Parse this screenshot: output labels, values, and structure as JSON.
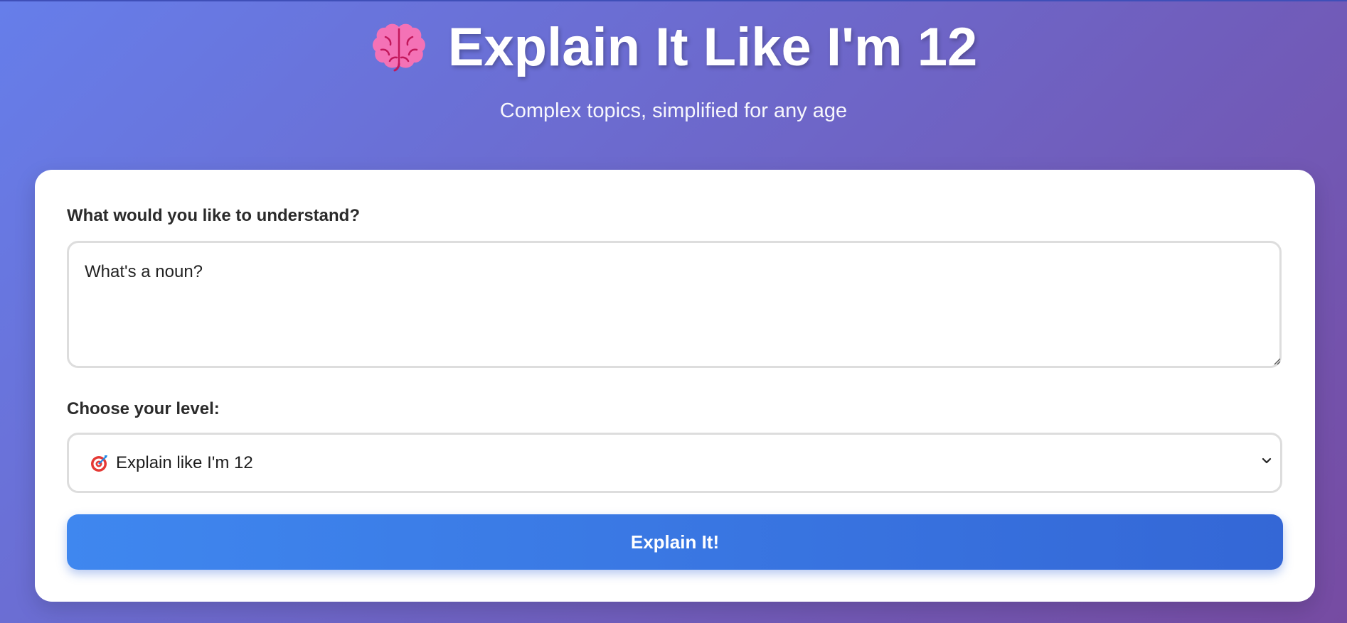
{
  "header": {
    "title": "Explain It Like I'm 12",
    "title_icon": "brain-icon",
    "subtitle": "Complex topics, simplified for any age"
  },
  "form": {
    "question_label": "What would you like to understand?",
    "question_value": "What's a noun?",
    "level_label": "Choose your level:",
    "level_icon": "target-icon",
    "level_selected": "Explain like I'm 12",
    "submit_label": "Explain It!"
  },
  "colors": {
    "background_start": "#667eea",
    "background_end": "#764ba2",
    "button_start": "#3f87ef",
    "button_end": "#3467d6",
    "brain_pink": "#f472b6"
  }
}
